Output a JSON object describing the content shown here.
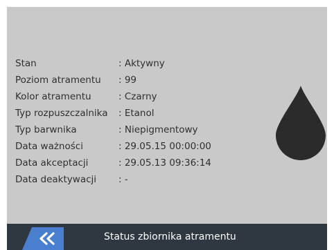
{
  "info": {
    "rows": [
      {
        "label": "Stan",
        "value": ": Aktywny"
      },
      {
        "label": "Poziom atramentu",
        "value": ": 99"
      },
      {
        "label": "Kolor atramentu",
        "value": ": Czarny"
      },
      {
        "label": "Typ rozpuszczalnika",
        "value": ": Etanol"
      },
      {
        "label": "Typ barwnika",
        "value": ": Niepigmentowy"
      },
      {
        "label": "Data ważności",
        "value": ": 29.05.15 00:00:00"
      },
      {
        "label": "Data akceptacji",
        "value": ": 29.05.13 09:36:14"
      },
      {
        "label": "Data deaktywacji",
        "value": ": -"
      }
    ]
  },
  "status_icon": {
    "name": "ink-drop-icon",
    "color": "#2b2b2b"
  },
  "footer": {
    "back_icon": "double-chevron-left-icon",
    "back_color": "#4a7fd0",
    "title": "Status zbiornika atramentu"
  }
}
